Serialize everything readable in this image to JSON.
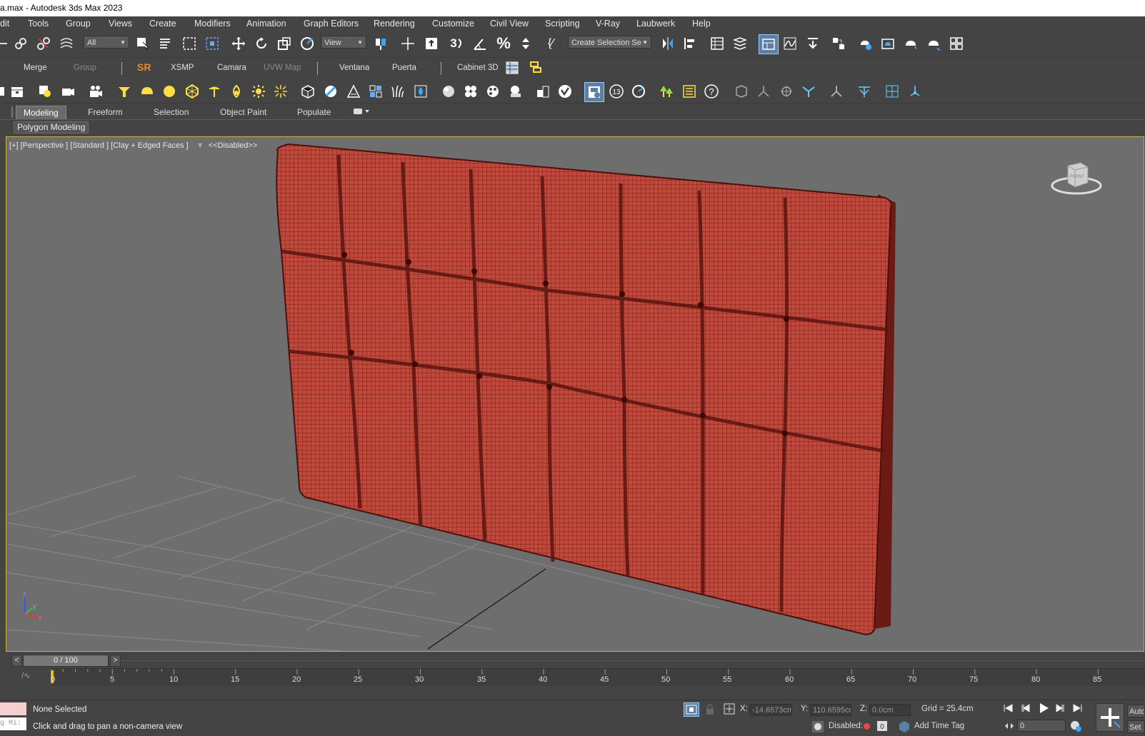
{
  "window": {
    "title": "a.max - Autodesk 3ds Max 2023"
  },
  "menu": [
    "dit",
    "Tools",
    "Group",
    "Views",
    "Create",
    "Modifiers",
    "Animation",
    "Graph Editors",
    "Rendering",
    "Customize",
    "Civil View",
    "Scripting",
    "V-Ray",
    "Laubwerk",
    "Help"
  ],
  "toolbar": {
    "selection_filter": "All",
    "ref_coord": "View",
    "named_selection": "Create Selection Se"
  },
  "custom_toolbar": {
    "merge": "Merge",
    "group": "Group",
    "sr": "SR",
    "xsmp": "XSMP",
    "camara": "Camara",
    "uvw_map": "UVW Map",
    "ventana": "Ventana",
    "puerta": "Puerta",
    "cabinet": "Cabinet 3D"
  },
  "ribbon": {
    "tabs": [
      "Modeling",
      "Freeform",
      "Selection",
      "Object Paint",
      "Populate"
    ],
    "active_tab": "Modeling",
    "panel_label": "Polygon Modeling"
  },
  "viewport": {
    "label": "[+] [Perspective ] [Standard ] [Clay + Edged Faces ]",
    "filter_label": "<<Disabled>>",
    "viewcube_label": "FRONT"
  },
  "timeline": {
    "prev": "<",
    "next": ">",
    "frame": "0 / 100",
    "ticks": [
      "0",
      "5",
      "10",
      "15",
      "20",
      "25",
      "30",
      "35",
      "40",
      "45",
      "50",
      "55",
      "60",
      "65",
      "70",
      "75",
      "80",
      "85"
    ]
  },
  "status": {
    "selection": "None Selected",
    "prompt": "Click and drag to pan a non-camera view",
    "maxscript": "g Mi:",
    "x_label": "X:",
    "x_value": "-14.6573cm",
    "y_label": "Y:",
    "y_value": "110.6595cm",
    "z_label": "Z:",
    "z_value": "0.0cm",
    "grid": "Grid = 25.4cm",
    "disabled_label": "Disabled:",
    "add_time_tag": "Add Time Tag",
    "frame_value": "0",
    "auto": "Auto",
    "set": "Set"
  },
  "colors": {
    "ui_bg": "#444444",
    "viewport_bg": "#6e6e6e",
    "viewport_border": "#c8b048",
    "object": "#c0493d",
    "object_wire": "#5a1510"
  }
}
